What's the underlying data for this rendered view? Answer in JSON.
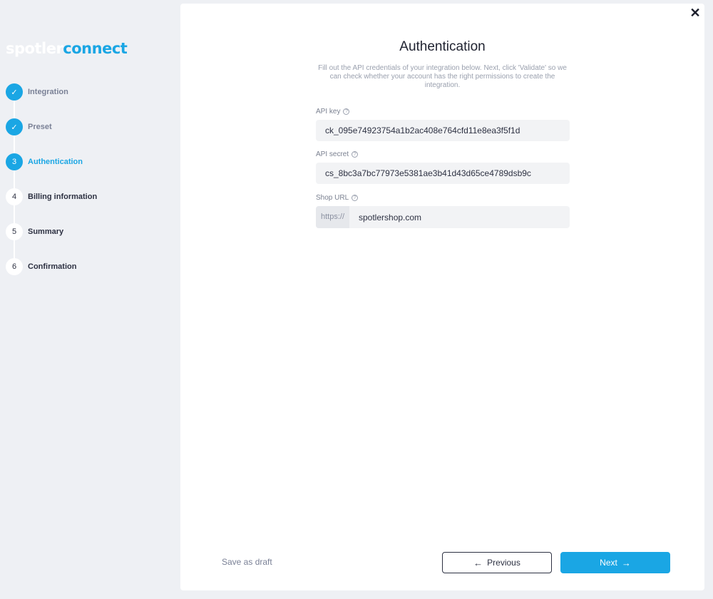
{
  "logo": {
    "part1": "spotler",
    "part2": "connect"
  },
  "steps": [
    {
      "marker": "✓",
      "label": "Integration",
      "state": "done"
    },
    {
      "marker": "✓",
      "label": "Preset",
      "state": "done"
    },
    {
      "marker": "3",
      "label": "Authentication",
      "state": "active"
    },
    {
      "marker": "4",
      "label": "Billing information",
      "state": "todo"
    },
    {
      "marker": "5",
      "label": "Summary",
      "state": "todo"
    },
    {
      "marker": "6",
      "label": "Confirmation",
      "state": "todo"
    }
  ],
  "close": "✕",
  "form": {
    "title": "Authentication",
    "subtitle": "Fill out the API credentials of your integration below. Next, click 'Validate' so we can check whether your account has the right permissions to create the integration.",
    "help_glyph": "?",
    "api_key": {
      "label": "API key",
      "value": "ck_095e74923754a1b2ac408e764cfd11e8ea3f5f1d"
    },
    "api_secret": {
      "label": "API secret",
      "value": "cs_8bc3a7bc77973e5381ae3b41d43d65ce4789dsb9c"
    },
    "shop_url": {
      "label": "Shop URL",
      "prefix": "https://",
      "value": "spotlershop.com"
    }
  },
  "footer": {
    "save_draft": "Save as draft",
    "previous": "Previous",
    "previous_arrow": "←",
    "next": "Next",
    "next_arrow": "→"
  },
  "colors": {
    "accent": "#1aa6e4",
    "sidebar_bg": "#eef0f4",
    "text_dark": "#2d3142"
  }
}
